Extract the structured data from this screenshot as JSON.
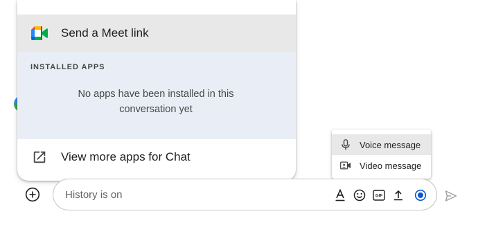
{
  "integration_menu": {
    "meet_item": {
      "label": "Send a Meet link",
      "icon": "google-meet-icon"
    },
    "installed_apps": {
      "heading": "INSTALLED APPS",
      "empty_message": "No apps have been installed in this conversation yet"
    },
    "more_apps_item": {
      "label": "View more apps for Chat",
      "icon": "open-in-new-icon"
    }
  },
  "media_menu": {
    "items": [
      {
        "label": "Voice message",
        "icon": "microphone-icon"
      },
      {
        "label": "Video message",
        "icon": "video-camera-icon"
      }
    ]
  },
  "composer": {
    "placeholder": "History is on",
    "add_icon": "add-circle-icon",
    "tools": [
      "format-text-icon",
      "emoji-icon",
      "gif-icon",
      "upload-icon",
      "record-icon"
    ],
    "send_icon": "send-icon"
  },
  "colors": {
    "menu_highlight": "#e8e8e8",
    "installed_background": "#e9eef6",
    "accent_blue": "#0b57d0",
    "icon_gray": "#444746"
  }
}
